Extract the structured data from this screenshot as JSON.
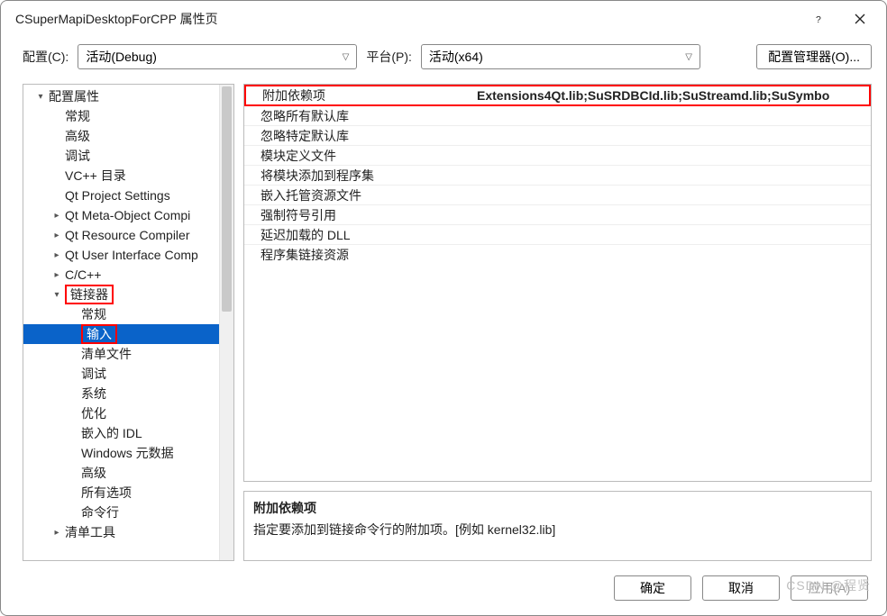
{
  "window": {
    "title": "CSuperMapiDesktopForCPP 属性页"
  },
  "toolbar": {
    "config_label": "配置(C):",
    "config_value": "活动(Debug)",
    "platform_label": "平台(P):",
    "platform_value": "活动(x64)",
    "config_manager": "配置管理器(O)..."
  },
  "tree": {
    "root": "配置属性",
    "items_lvl2": [
      "常规",
      "高级",
      "调试",
      "VC++ 目录",
      "Qt Project Settings",
      "Qt Meta-Object Compi",
      "Qt Resource Compiler",
      "Qt User Interface Comp",
      "C/C++"
    ],
    "linker": "链接器",
    "linker_children": [
      "常规",
      "输入",
      "清单文件",
      "调试",
      "系统",
      "优化",
      "嵌入的 IDL",
      "Windows 元数据",
      "高级",
      "所有选项",
      "命令行"
    ],
    "manifest_tool": "清单工具"
  },
  "grid": {
    "rows": [
      {
        "name": "附加依赖项",
        "value": "Extensions4Qt.lib;SuSRDBCId.lib;SuStreamd.lib;SuSymbo"
      },
      {
        "name": "忽略所有默认库",
        "value": ""
      },
      {
        "name": "忽略特定默认库",
        "value": ""
      },
      {
        "name": "模块定义文件",
        "value": ""
      },
      {
        "name": "将模块添加到程序集",
        "value": ""
      },
      {
        "name": "嵌入托管资源文件",
        "value": ""
      },
      {
        "name": "强制符号引用",
        "value": ""
      },
      {
        "name": "延迟加载的 DLL",
        "value": ""
      },
      {
        "name": "程序集链接资源",
        "value": ""
      }
    ]
  },
  "description": {
    "title": "附加依赖项",
    "text": "指定要添加到链接命令行的附加项。[例如 kernel32.lib]"
  },
  "footer": {
    "ok": "确定",
    "cancel": "取消",
    "apply": "应用(A)"
  },
  "watermark": "CSDN @程贤"
}
